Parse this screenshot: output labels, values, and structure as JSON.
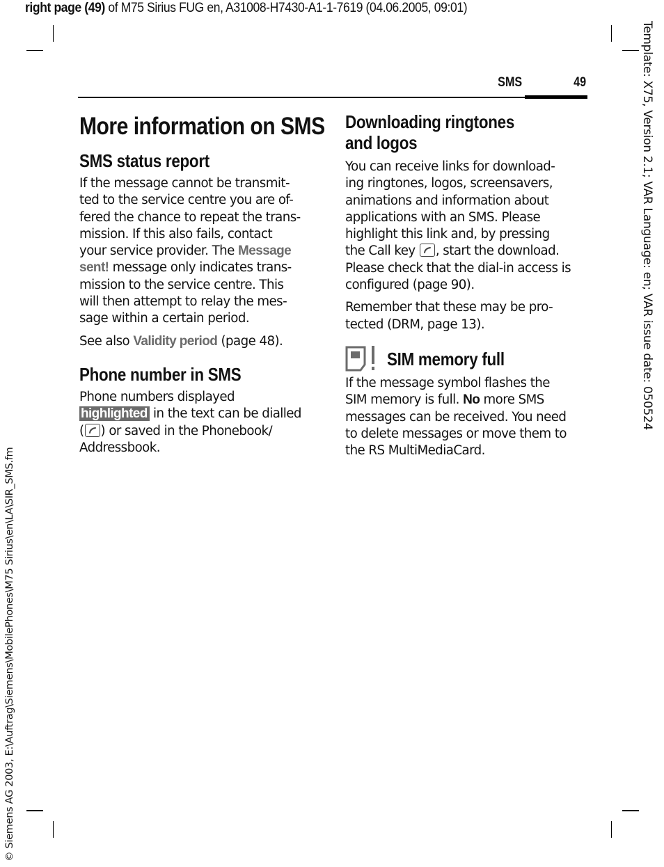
{
  "page_meta": {
    "header_bold": "right page (49)",
    "header_rest": " of M75 Sirius FUG en, A31008-H7430-A1-1-7619 (04.06.2005, 09:01)",
    "side_right": "Template: X75, Version 2.1; VAR Language: en; VAR issue date: 050524",
    "side_left": "© Siemens AG 2003, E:\\Auftrag\\Siemens\\MobilePhones\\M75 Sirius\\en\\LA\\SIR_SMS.fm"
  },
  "running_head": {
    "section": "SMS",
    "page_number": "49"
  },
  "left_column": {
    "title": "More information on SMS",
    "status_report": {
      "heading": "SMS status report",
      "lines": [
        "If the message cannot be transmit-",
        "ted to the service centre you are of-",
        "fered the chance to repeat the trans-",
        "mission. If this also fails, contact"
      ],
      "line5_pre": "your service provider. The ",
      "term_message": "Message",
      "term_sent": "sent!",
      "line6_post": " message only indicates trans-",
      "lines_after": [
        "mission to the service centre. This",
        "will then attempt to relay the mes-",
        "sage within a certain period."
      ],
      "see_also_pre": "See also ",
      "see_also_term": "Validity period",
      "see_also_post": " (page 48)."
    },
    "phone_number": {
      "heading": "Phone number in SMS",
      "line1": "Phone numbers displayed",
      "highlight_term": "highlighted",
      "line2_post": " in the text can be dialled",
      "line3_pre": "(",
      "line3_post": ") or saved in the Phonebook/",
      "line4": "Addressbook."
    }
  },
  "right_column": {
    "downloading": {
      "heading_line1": "Downloading ringtones",
      "heading_line2": "and logos",
      "lines": [
        "You can receive links for download-",
        "ing ringtones, logos, screensavers,",
        "animations and information about",
        "applications with an SMS. Please",
        "highlight this link and, by pressing"
      ],
      "call_pre": "the Call key ",
      "call_post": ", start the download.",
      "lines_after": [
        "Please check that the dial-in access is",
        "configured (page 90)."
      ],
      "drm_lines": [
        "Remember that these may be pro-",
        "tected (DRM, page 13)."
      ]
    },
    "sim_full": {
      "heading": "SIM memory full",
      "icon": "sim-card-warning-icon",
      "line1": "If the message symbol flashes the",
      "line2_pre": "SIM memory is full. ",
      "line2_bold": "No",
      "line2_post": " more SMS",
      "lines_after": [
        "messages can be received. You need",
        "to delete messages or move them to",
        "the RS MultiMediaCard."
      ]
    }
  },
  "icons": {
    "call_key": "call-key-icon",
    "sim_warning": "sim-card-warning-icon"
  },
  "colors": {
    "ui_term": "#6b6b6b",
    "highlight_bg": "#6b6b6b",
    "text": "#111111"
  }
}
